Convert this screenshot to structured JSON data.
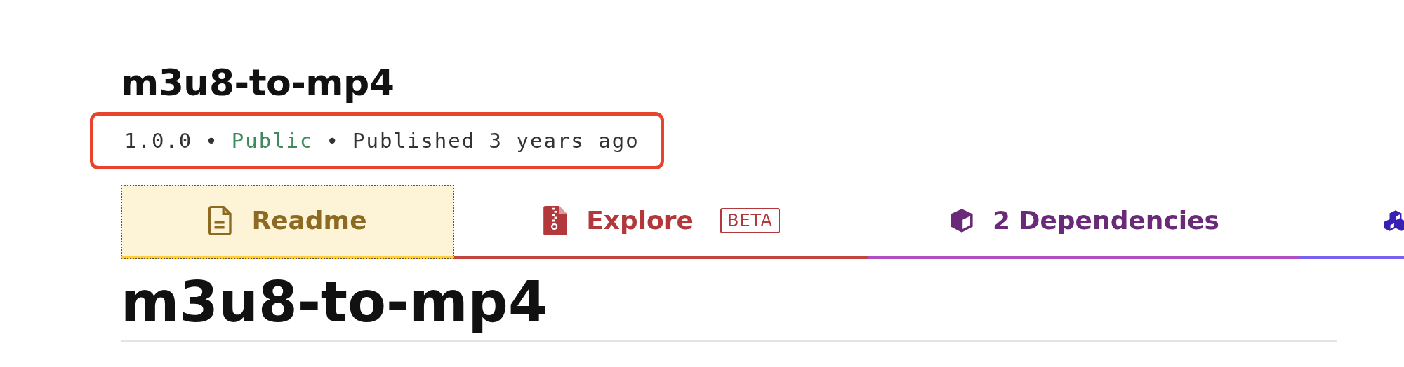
{
  "package": {
    "name": "m3u8-to-mp4"
  },
  "meta": [
    {
      "kind": "plain",
      "text": "1.0.0"
    },
    {
      "kind": "separator",
      "text": "•"
    },
    {
      "kind": "public",
      "text": "Public"
    },
    {
      "kind": "separator",
      "text": "•"
    },
    {
      "kind": "plain",
      "text": "Published 3 years ago"
    }
  ],
  "tabs": [
    {
      "kind": "readme",
      "label": "Readme",
      "selected": true,
      "color": "#8c6a22"
    },
    {
      "kind": "explore",
      "label": "Explore",
      "badge": "BETA",
      "selected": false,
      "color": "#b2383c"
    },
    {
      "kind": "dependencies",
      "label": "2 Dependencies",
      "selected": false,
      "color": "#6a2a7a"
    },
    {
      "kind": "dependents",
      "selected": false,
      "color": "#3a1fb5"
    }
  ],
  "readme": {
    "heading": "m3u8-to-mp4"
  }
}
